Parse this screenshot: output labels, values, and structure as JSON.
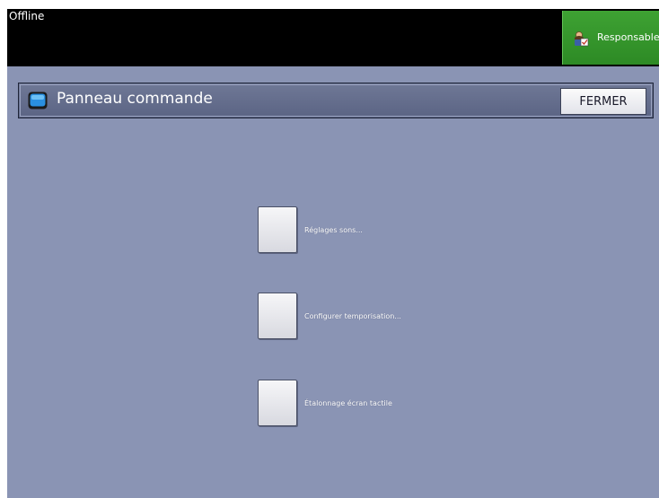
{
  "status": {
    "text": "Offline"
  },
  "user": {
    "label": "Responsable",
    "icon": "user-admin-icon",
    "color": "#3ea233"
  },
  "header": {
    "title": "Panneau commande",
    "icon": "panel-screen-icon",
    "close_label": "FERMER"
  },
  "options": [
    {
      "label": "Réglages sons..."
    },
    {
      "label": "Configurer temporisation..."
    },
    {
      "label": "Étalonnage écran tactile"
    }
  ],
  "colors": {
    "background": "#8a94b4",
    "topbar": "#000000",
    "accent": "#3ea233"
  }
}
